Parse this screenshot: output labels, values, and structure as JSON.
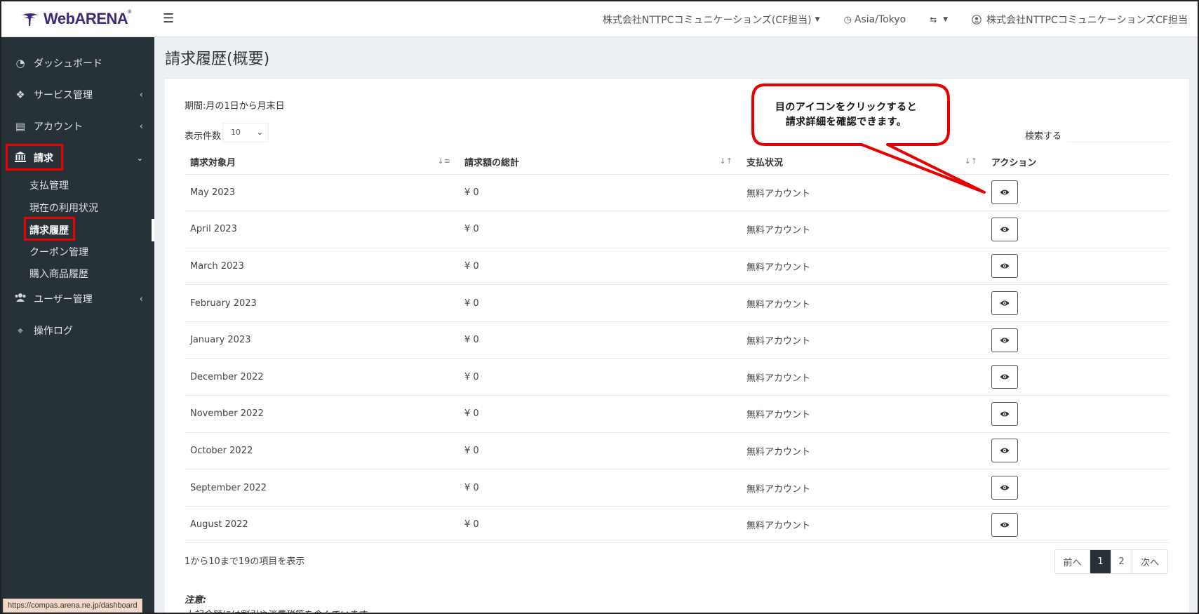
{
  "brand": {
    "name": "WebARENA"
  },
  "header": {
    "company": "株式会社NTTPCコミュニケーションズ(CF担当)",
    "timezone": "Asia/Tokyo",
    "user": "株式会社NTTPCコミュニケーションズCF担当"
  },
  "sidebar": {
    "items": [
      {
        "label": "ダッシュボード",
        "icon": "tachometer-icon"
      },
      {
        "label": "サービス管理",
        "icon": "cubes-icon"
      },
      {
        "label": "アカウント",
        "icon": "id-card-icon"
      },
      {
        "label": "請求",
        "icon": "bank-icon"
      },
      {
        "label": "ユーザー管理",
        "icon": "users-icon"
      },
      {
        "label": "操作ログ",
        "icon": "crosshairs-icon"
      }
    ],
    "billing_submenu": [
      "支払管理",
      "現在の利用状況",
      "請求履歴",
      "クーポン管理",
      "購入商品履歴"
    ]
  },
  "page": {
    "title": "請求履歴(概要)",
    "period": "期間:月の1日から月末日",
    "length_label": "表示件数",
    "length_value": "10",
    "search_label": "検索する"
  },
  "table": {
    "headers": [
      "請求対象月",
      "請求額の総計",
      "支払状況",
      "アクション"
    ],
    "rows": [
      {
        "month": "May 2023",
        "amount": "¥ 0",
        "status": "無料アカウント"
      },
      {
        "month": "April 2023",
        "amount": "¥ 0",
        "status": "無料アカウント"
      },
      {
        "month": "March 2023",
        "amount": "¥ 0",
        "status": "無料アカウント"
      },
      {
        "month": "February 2023",
        "amount": "¥ 0",
        "status": "無料アカウント"
      },
      {
        "month": "January 2023",
        "amount": "¥ 0",
        "status": "無料アカウント"
      },
      {
        "month": "December 2022",
        "amount": "¥ 0",
        "status": "無料アカウント"
      },
      {
        "month": "November 2022",
        "amount": "¥ 0",
        "status": "無料アカウント"
      },
      {
        "month": "October 2022",
        "amount": "¥ 0",
        "status": "無料アカウント"
      },
      {
        "month": "September 2022",
        "amount": "¥ 0",
        "status": "無料アカウント"
      },
      {
        "month": "August 2022",
        "amount": "¥ 0",
        "status": "無料アカウント"
      }
    ]
  },
  "footer": {
    "info": "1から10まで19の項目を表示",
    "pagination": {
      "prev": "前へ",
      "pages": [
        "1",
        "2"
      ],
      "current": "1",
      "next": "次へ"
    },
    "note_title": "注意:",
    "note_text": "上記金額には割引や消費税等を含んでいます。"
  },
  "callout": {
    "line1": "目のアイコンをクリックすると",
    "line2": "請求詳細を確認できます。"
  },
  "status_url": "https://compas.arena.ne.jp/dashboard"
}
